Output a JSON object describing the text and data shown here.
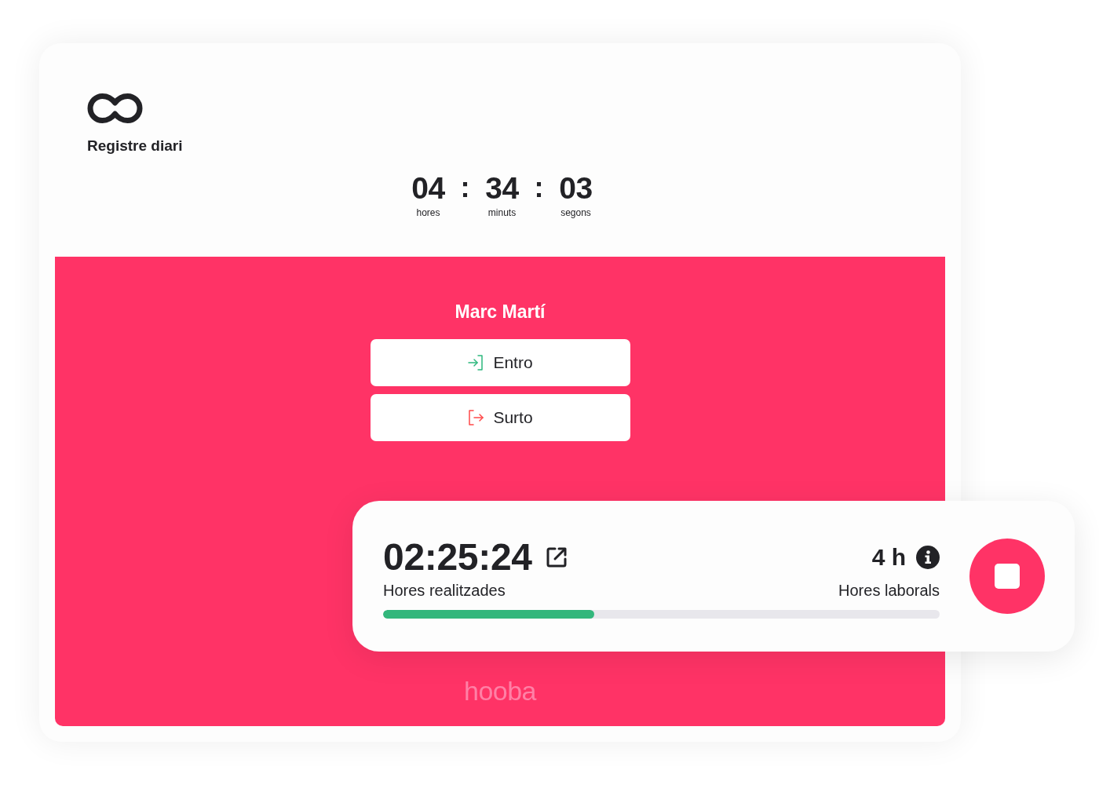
{
  "header": {
    "title": "Registre diari"
  },
  "clock": [
    {
      "kind": "unit",
      "value": "04",
      "label": "hores"
    },
    {
      "kind": "separator",
      "value": ":"
    },
    {
      "kind": "unit",
      "value": "34",
      "label": "minuts"
    },
    {
      "kind": "separator",
      "value": ":"
    },
    {
      "kind": "unit",
      "value": "03",
      "label": "segons"
    }
  ],
  "employee": {
    "name": "Marc Martí"
  },
  "actions": [
    {
      "kind": "clock-in",
      "label": "Entro"
    },
    {
      "kind": "clock-out",
      "label": "Surto"
    }
  ],
  "brand": "hooba",
  "tracker": {
    "elapsed": "02:25:24",
    "elapsed_label": "Hores realitzades",
    "target": "4 h",
    "target_label": "Hores laborals",
    "level": 0.38
  }
}
